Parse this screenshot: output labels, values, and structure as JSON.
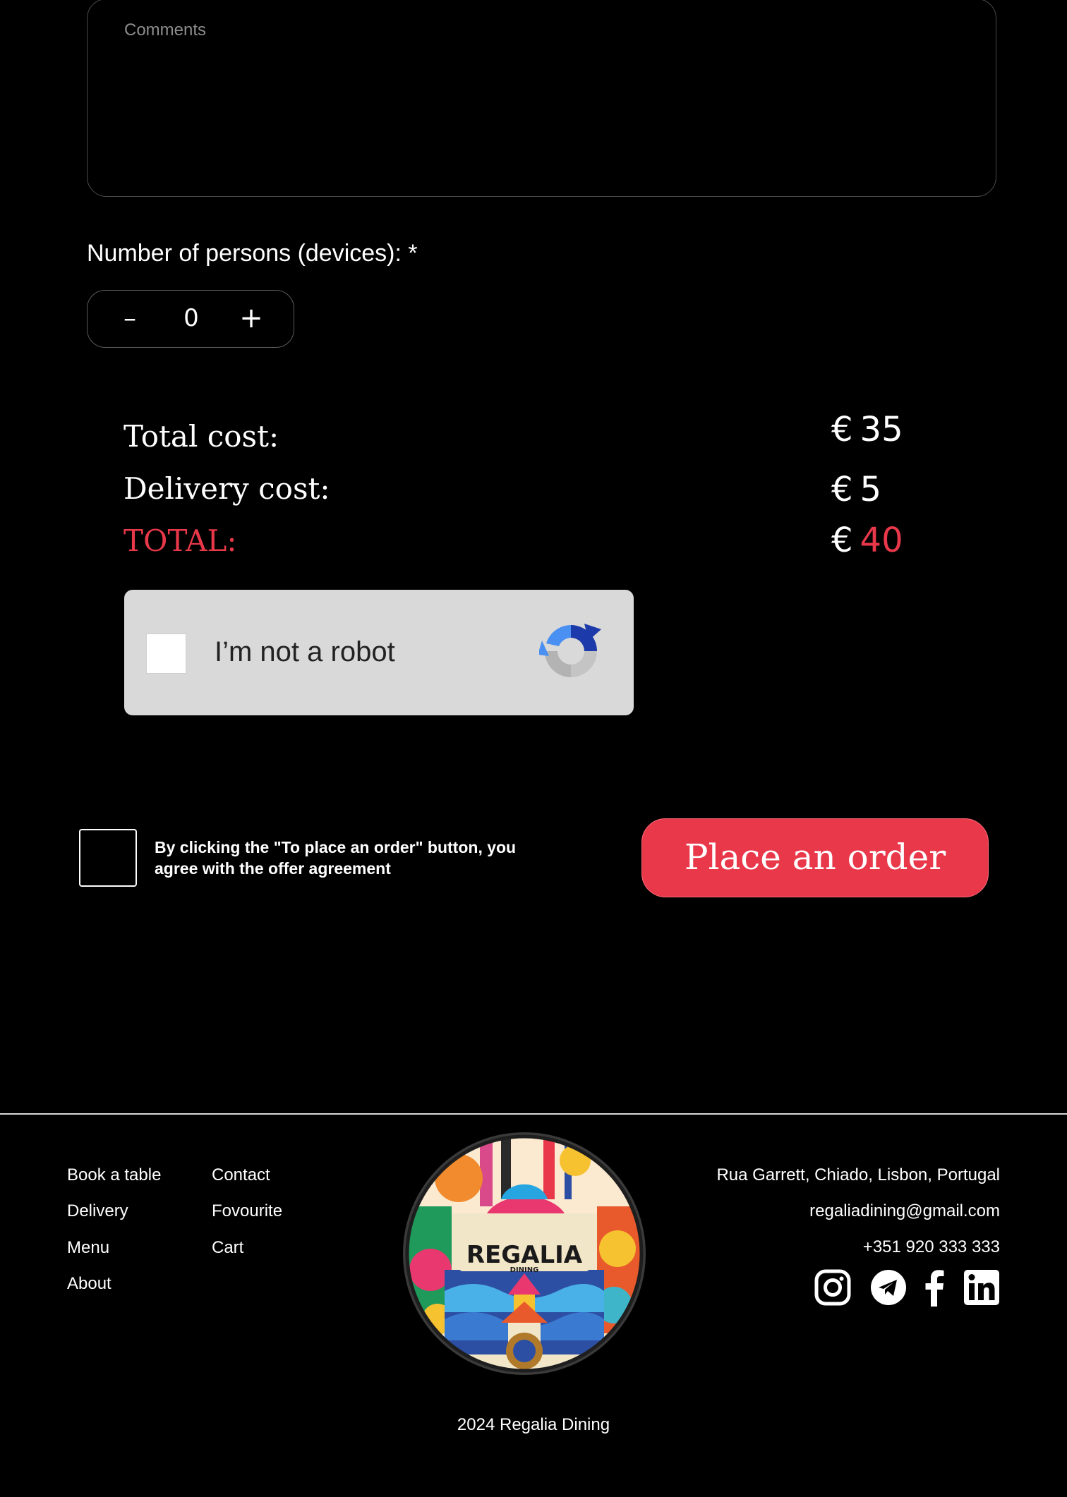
{
  "comments": {
    "placeholder": "Comments"
  },
  "persons": {
    "label": "Number of persons (devices): *",
    "minus": "–",
    "value": "0",
    "plus": "+"
  },
  "costs": {
    "currency": "€",
    "total_label": "Total cost:",
    "total_value": "35",
    "delivery_label": "Delivery cost:",
    "delivery_value": "5",
    "grand_label": "TOTAL:",
    "grand_value": "40"
  },
  "recaptcha": {
    "label": "I’m not a robot"
  },
  "agreement": {
    "text": "By clicking the \"To place an order\" button, you agree with the offer agreement"
  },
  "order_button": {
    "label": "Place an order"
  },
  "footer": {
    "nav_col1": [
      "Book a table",
      "Delivery",
      "Menu",
      "About"
    ],
    "nav_col2": [
      "Contact",
      "Fovourite",
      "Cart"
    ],
    "logo_text": "REGALIA",
    "logo_subtext": "DINING",
    "address": "Rua Garrett, Chiado, Lisbon, Portugal",
    "email": "regaliadining@gmail.com",
    "phone": "+351 920 333 333",
    "social_icons": [
      "instagram-icon",
      "telegram-icon",
      "facebook-icon",
      "linkedin-icon"
    ],
    "copyright": "2024  Regalia Dining"
  },
  "colors": {
    "accent": "#e8384a",
    "background": "#000000",
    "recaptcha_bg": "#d9d9d9"
  }
}
